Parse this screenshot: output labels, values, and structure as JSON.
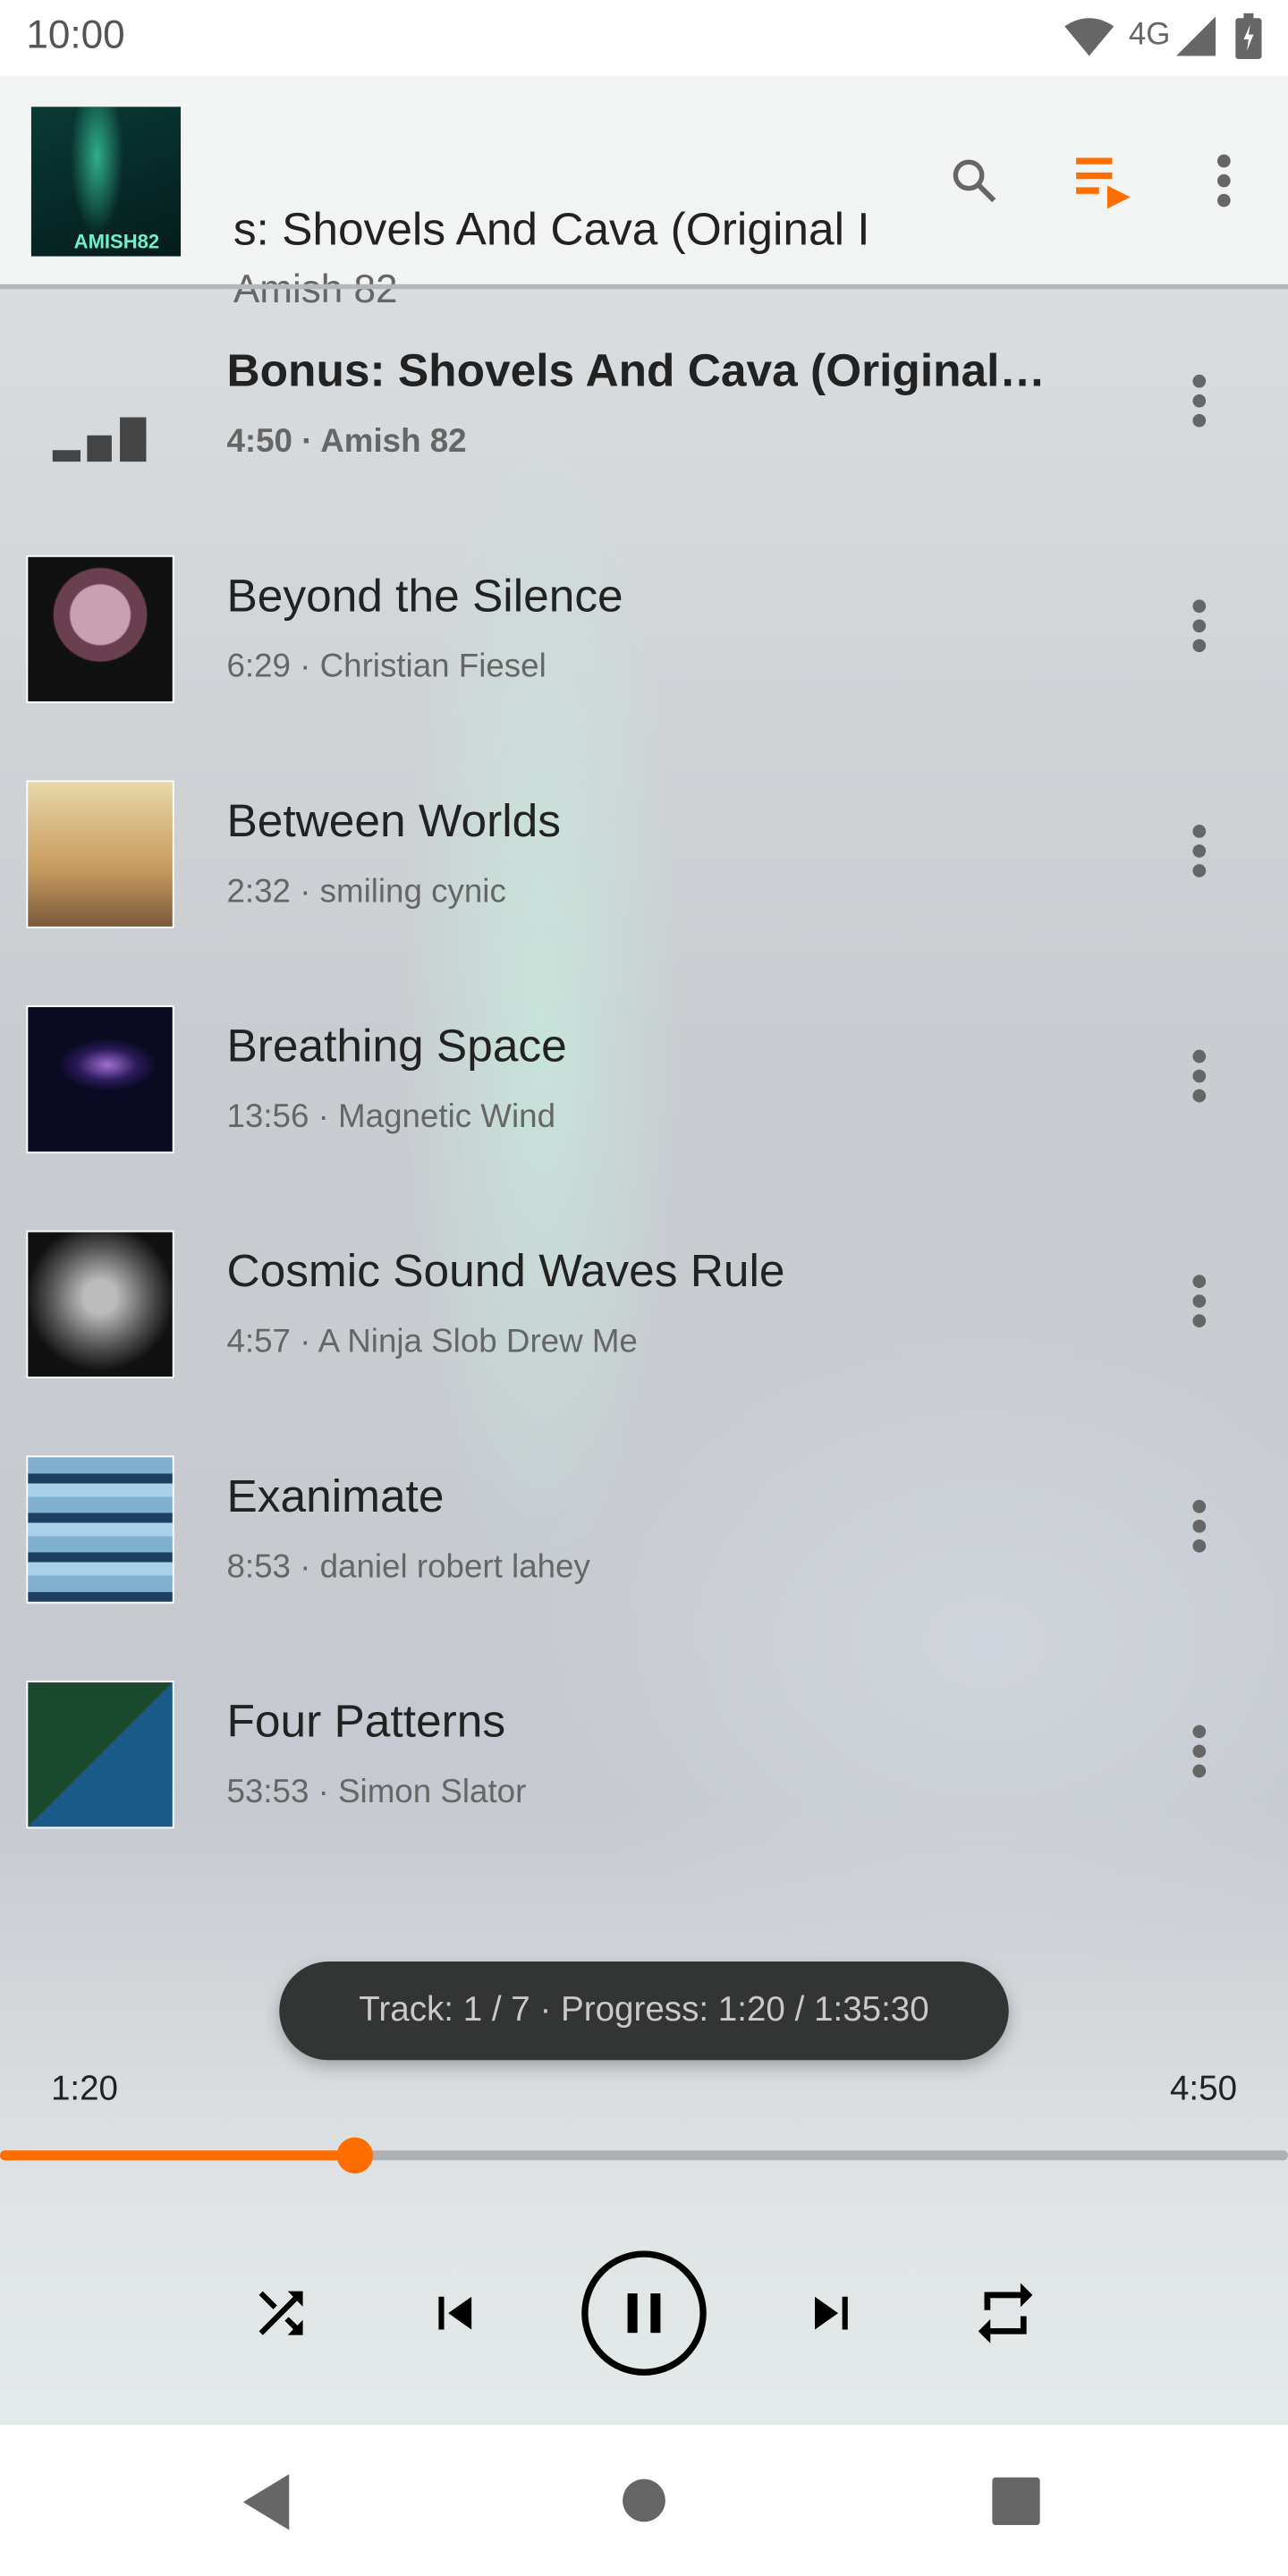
{
  "status_bar": {
    "time": "10:00",
    "network": "4G",
    "icons": [
      "wifi-icon",
      "cell-signal-icon",
      "battery-charging-icon"
    ]
  },
  "header": {
    "title": "s: Shovels And Cava (Original I",
    "artist": "Amish 82",
    "art_label": "AMISH82",
    "actions": [
      "search-icon",
      "queue-icon",
      "more-vert-icon"
    ]
  },
  "colors": {
    "accent": "#ff6d00",
    "toast_bg": "#333434"
  },
  "tracks": [
    {
      "title": "Bonus: Shovels And Cava (Original…",
      "sub": "4:50 · Amish 82",
      "playing": true
    },
    {
      "title": "Beyond the Silence",
      "sub": "6:29 · Christian Fiesel",
      "art_label": "reflection"
    },
    {
      "title": "Between Worlds",
      "sub": "2:32 · smiling cynic"
    },
    {
      "title": "Breathing Space",
      "sub": "13:56 · Magnetic Wind"
    },
    {
      "title": "Cosmic Sound Waves Rule",
      "sub": "4:57 · A Ninja Slob Drew Me"
    },
    {
      "title": "Exanimate",
      "sub": "8:53 · daniel robert lahey"
    },
    {
      "title": "Four Patterns",
      "sub": "53:53 · Simon Slator"
    }
  ],
  "toast": "Track: 1 / 7  ·  Progress: 1:20 / 1:35:30",
  "player": {
    "elapsed": "1:20",
    "duration": "4:50",
    "progress_fraction": 0.276,
    "controls": [
      "shuffle-icon",
      "skip-previous-icon",
      "pause-icon",
      "skip-next-icon",
      "repeat-icon"
    ]
  },
  "nav": [
    "back-icon",
    "home-icon",
    "recents-icon"
  ]
}
